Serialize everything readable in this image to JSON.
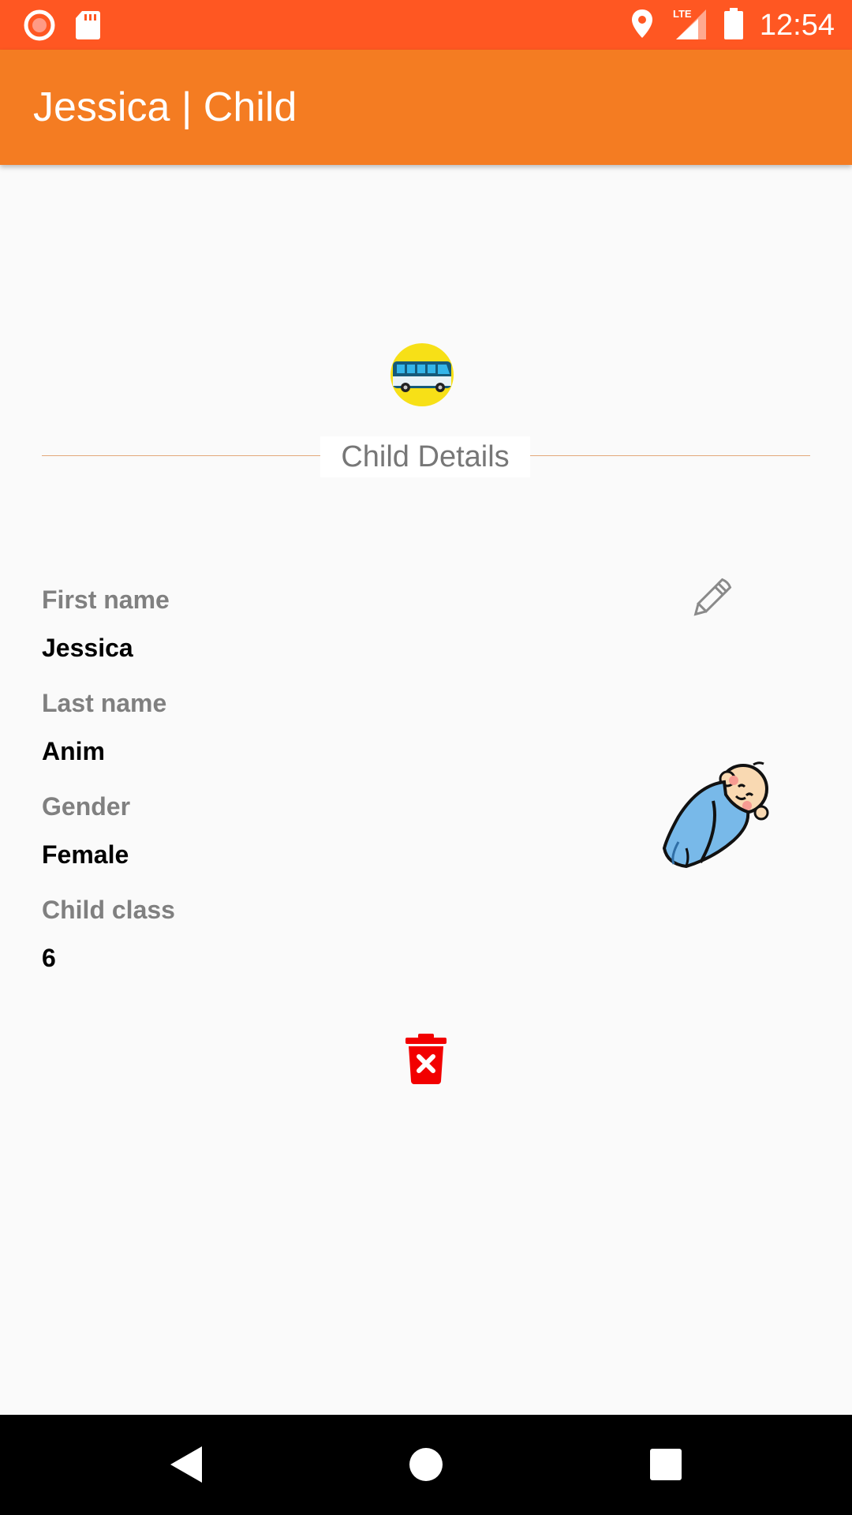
{
  "status_bar": {
    "time": "12:54",
    "network": "LTE",
    "icons": [
      "record-icon",
      "sd-card-icon",
      "location-icon",
      "lte-signal-icon",
      "battery-icon"
    ]
  },
  "app_bar": {
    "title": "Jessica | Child"
  },
  "section": {
    "title": "Child Details"
  },
  "fields": [
    {
      "label": "First name",
      "value": "Jessica"
    },
    {
      "label": "Last name",
      "value": "Anim"
    },
    {
      "label": "Gender",
      "value": "Female"
    },
    {
      "label": "Child class",
      "value": "6"
    }
  ],
  "colors": {
    "status_bar": "#ff5722",
    "app_bar": "#f47c22",
    "divider": "#e3a87a",
    "delete": "#ff0000"
  },
  "icons": {
    "logo": "bus-logo-icon",
    "edit": "pencil-icon",
    "avatar": "baby-icon",
    "delete": "trash-delete-icon"
  },
  "nav": [
    "back-icon",
    "home-icon",
    "recents-icon"
  ]
}
